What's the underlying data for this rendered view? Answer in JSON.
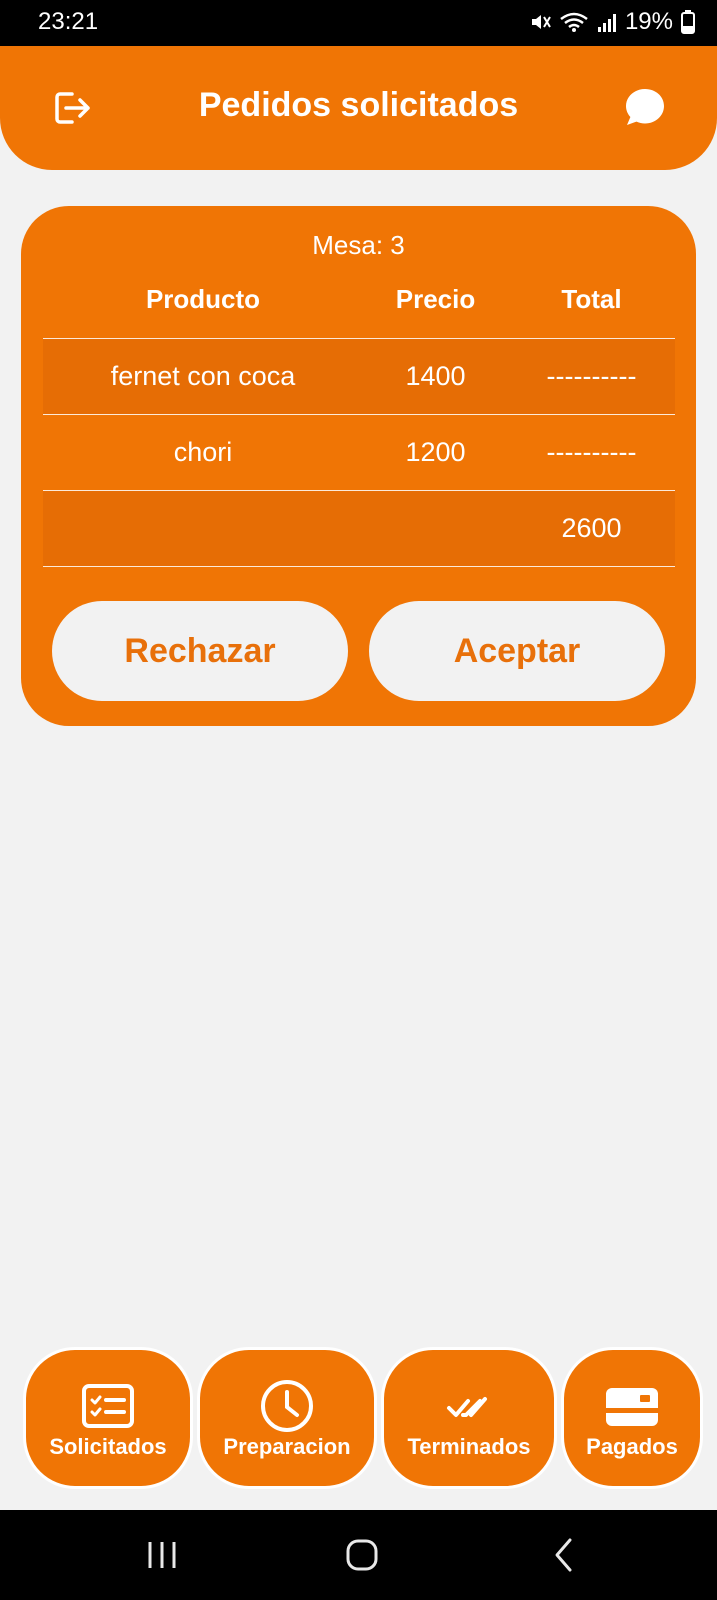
{
  "status_bar": {
    "time": "23:21",
    "battery": "19%",
    "icons": [
      "mute-icon",
      "wifi-icon",
      "signal-icon",
      "battery-icon"
    ]
  },
  "header": {
    "title": "Pedidos solicitados",
    "left_icon": "logout-icon",
    "right_icon": "chat-icon"
  },
  "order": {
    "mesa": "Mesa: 3",
    "columns": {
      "product": "Producto",
      "price": "Precio",
      "total": "Total"
    },
    "items": [
      {
        "product": "fernet con coca",
        "price": "1400",
        "total": "----------"
      },
      {
        "product": "chori",
        "price": "1200",
        "total": "----------"
      }
    ],
    "grand_total": "2600",
    "reject_label": "Rechazar",
    "accept_label": "Aceptar"
  },
  "tabs": [
    {
      "label": "Solicitados",
      "icon": "checklist-icon"
    },
    {
      "label": "Preparacion",
      "icon": "clock-icon"
    },
    {
      "label": "Terminados",
      "icon": "double-check-icon"
    },
    {
      "label": "Pagados",
      "icon": "credit-card-icon"
    }
  ],
  "colors": {
    "accent": "#f07505",
    "accent_shade": "#e66d05",
    "background": "#f2f2f2",
    "button_text": "#e8700a"
  }
}
